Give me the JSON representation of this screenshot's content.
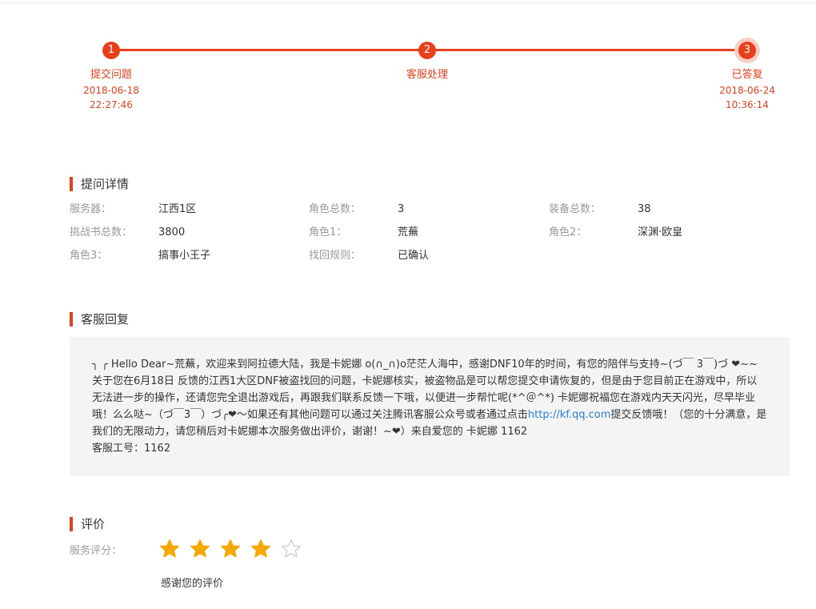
{
  "progress": {
    "steps": [
      {
        "num": "1",
        "label": "提交问题",
        "date": "2018-06-18",
        "time": "22:27:46"
      },
      {
        "num": "2",
        "label": "客服处理",
        "date": "",
        "time": ""
      },
      {
        "num": "3",
        "label": "已答复",
        "date": "2018-06-24",
        "time": "10:36:14"
      }
    ]
  },
  "details": {
    "title": "提问详情",
    "rows": [
      [
        {
          "key": "服务器：",
          "value": "江西1区"
        },
        {
          "key": "角色总数：",
          "value": "3"
        },
        {
          "key": "装备总数：",
          "value": "38"
        }
      ],
      [
        {
          "key": "挑战书总数：",
          "value": "3800"
        },
        {
          "key": "角色1：",
          "value": "荒蕪"
        },
        {
          "key": "角色2：",
          "value": "深渊·欧皇"
        }
      ],
      [
        {
          "key": "角色3：",
          "value": "搞事小王子"
        },
        {
          "key": "找回规则：",
          "value": "已确认"
        }
      ]
    ]
  },
  "reply": {
    "title": "客服回复",
    "text_before_link": "╮ ╭ Hello Dear~荒蕪，欢迎来到阿拉德大陆，我是卡妮娜 o(∩_∩)o茫茫人海中，感谢DNF10年的时间，有您的陪伴与支持~(づ￣ 3￣)づ ❤~~关于您在6月18日 反馈的江西1大区DNF被盗找回的问题，卡妮娜核实，被盗物品是可以帮您提交申请恢复的，但是由于您目前正在游戏中，所以无法进一步的操作，还请您完全退出游戏后，再跟我们联系反馈一下哦，以便进一步帮忙呢(*^＠^*) 卡妮娜祝福您在游戏内天天闪光，尽早毕业哦！么么哒~（づ￣3￣）づ╭❤～如果还有其他问题可以通过关注腾讯客服公众号或者通过点击",
    "link_text": "http://kf.qq.com",
    "text_after_link": "提交反馈哦！（您的十分满意，是我们的无限动力，请您稍后对卡妮娜本次服务做出评价，谢谢！~❤）来自爱您的 卡妮娜 1162",
    "staff_id": "客服工号：1162"
  },
  "rating": {
    "title": "评价",
    "label": "服务评分：",
    "score": 4,
    "max": 5,
    "note": "感谢您的评价",
    "star_color": "#f5a800",
    "star_empty_color": "#cccccc"
  },
  "colors": {
    "accent": "#e8401c",
    "link": "#2a7fd4"
  }
}
